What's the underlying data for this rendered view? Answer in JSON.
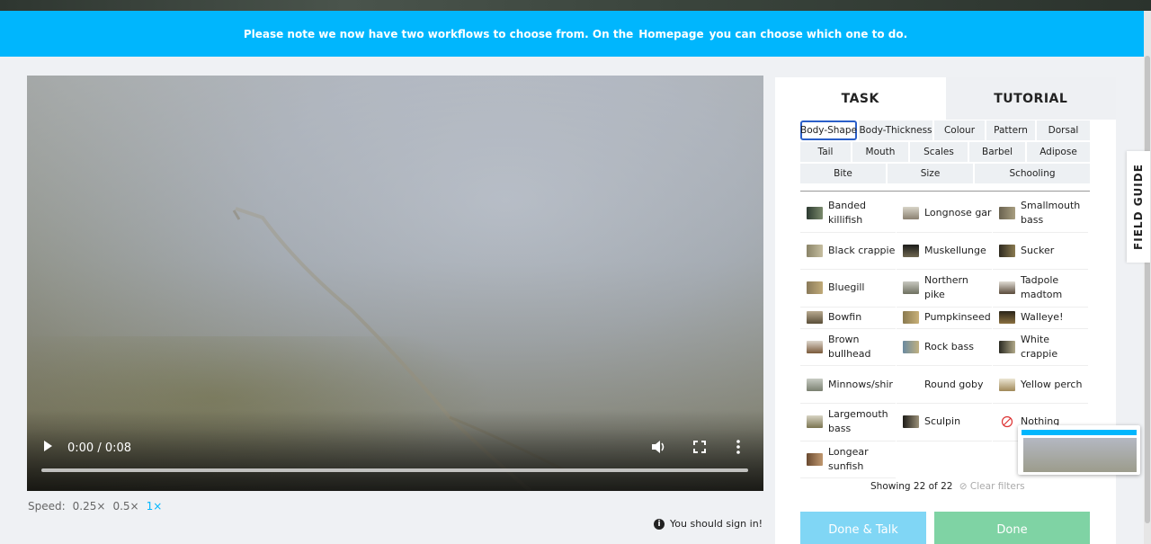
{
  "banner": {
    "text_before": "Please note we now have two workflows to choose from. On the",
    "link": "Homepage",
    "text_after": "you can choose which one to do."
  },
  "video": {
    "time": "0:00 / 0:08",
    "progress": 0
  },
  "speed": {
    "label": "Speed:",
    "options": [
      "0.25×",
      "0.5×",
      "1×"
    ],
    "selected": "1×"
  },
  "signin": "You should sign in!",
  "tabs": {
    "task": "TASK",
    "tutorial": "TUTORIAL"
  },
  "filters": {
    "row1": [
      "Body-Shape",
      "Body-Thickness",
      "Colour",
      "Pattern",
      "Dorsal"
    ],
    "row2": [
      "Tail",
      "Mouth",
      "Scales",
      "Barbel",
      "Adipose"
    ],
    "row3": [
      "Bite",
      "Size",
      "Schooling"
    ]
  },
  "species": [
    {
      "name": "Banded killifish",
      "icon": "fish-thumbnail"
    },
    {
      "name": "Longnose gar",
      "icon": "fish-thumbnail"
    },
    {
      "name": "Smallmouth bass",
      "icon": "fish-thumbnail"
    },
    {
      "name": "Black crappie",
      "icon": "fish-thumbnail"
    },
    {
      "name": "Muskellunge",
      "icon": "fish-thumbnail"
    },
    {
      "name": "Sucker",
      "icon": "fish-thumbnail"
    },
    {
      "name": "Bluegill",
      "icon": "fish-thumbnail"
    },
    {
      "name": "Northern pike",
      "icon": "fish-thumbnail"
    },
    {
      "name": "Tadpole madtom",
      "icon": "fish-thumbnail"
    },
    {
      "name": "Bowfin",
      "icon": "fish-thumbnail"
    },
    {
      "name": "Pumpkinseed",
      "icon": "fish-thumbnail"
    },
    {
      "name": "Walleye!",
      "icon": "fish-thumbnail"
    },
    {
      "name": "Brown bullhead",
      "icon": "fish-thumbnail"
    },
    {
      "name": "Rock bass",
      "icon": "fish-thumbnail"
    },
    {
      "name": "White crappie",
      "icon": "fish-thumbnail"
    },
    {
      "name": "Minnows/shir",
      "icon": "fish-thumbnail"
    },
    {
      "name": "Round goby",
      "icon": "none"
    },
    {
      "name": "Yellow perch",
      "icon": "fish-thumbnail"
    },
    {
      "name": "Largemouth bass",
      "icon": "fish-thumbnail"
    },
    {
      "name": "Sculpin",
      "icon": "fish-thumbnail"
    },
    {
      "name": "Nothing",
      "icon": "nothing-icon"
    },
    {
      "name": "Longear sunfish",
      "icon": "fish-thumbnail"
    }
  ],
  "showing": "Showing 22 of 22",
  "clear_filters": "Clear filters",
  "buttons": {
    "talk": "Done & Talk",
    "done": "Done"
  },
  "field_guide": "FIELD GUIDE",
  "colors": {
    "accent": "#00b6fd",
    "done": "#7fd3a4",
    "talk": "#80d6f5"
  }
}
